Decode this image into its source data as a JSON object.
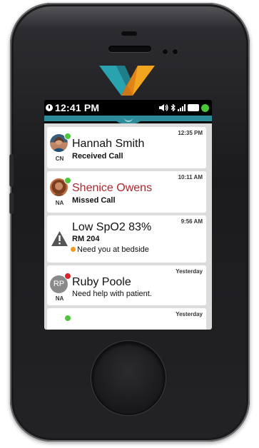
{
  "status_bar": {
    "time": "12:41 PM",
    "icons": [
      "clock-icon",
      "speaker-icon",
      "bluetooth-icon",
      "signal-icon",
      "battery-icon",
      "presence-icon"
    ],
    "presence_color": "#4cc73a"
  },
  "colors": {
    "accent_teal": "#2d8c9a",
    "missed_red": "#b0262b",
    "available_green": "#4cc73a",
    "busy_red": "#d8262d",
    "alert_orange": "#f39a1e"
  },
  "messages": [
    {
      "name": "Hannah Smith",
      "detail": "Received Call",
      "time": "12:35 PM",
      "initials": "CN",
      "avatar": "photo",
      "presence": "available"
    },
    {
      "name": "Shenice Owens",
      "detail": "Missed Call",
      "time": "10:11 AM",
      "initials": "NA",
      "avatar": "photo",
      "presence": "available"
    },
    {
      "title": "Low SpO2 83%",
      "room": "RM 204",
      "detail": "Need you at bedside",
      "time": "9:56 AM",
      "icon": "warning-icon"
    },
    {
      "name": "Ruby Poole",
      "detail": "Need help with patient.",
      "time": "Yesterday",
      "initials": "NA",
      "avatar_text": "RP",
      "presence": "busy"
    },
    {
      "time": "Yesterday"
    }
  ]
}
